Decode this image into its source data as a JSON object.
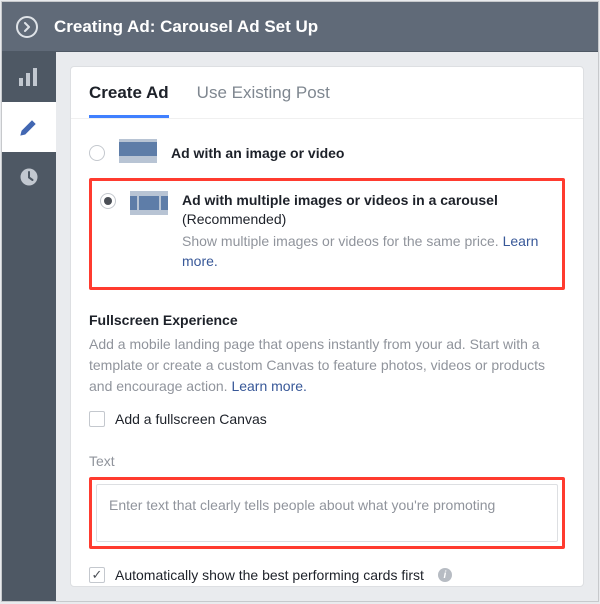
{
  "header": {
    "title": "Creating Ad: Carousel Ad Set Up"
  },
  "tabs": {
    "create": "Create Ad",
    "existing": "Use Existing Post"
  },
  "format": {
    "option1_label": "Ad with an image or video",
    "option2_label": "Ad with multiple images or videos in a carousel",
    "option2_rec": "(Recommended)",
    "option2_desc": "Show multiple images or videos for the same price. ",
    "option2_link": "Learn more."
  },
  "fullscreen": {
    "heading": "Fullscreen Experience",
    "desc": "Add a mobile landing page that opens instantly from your ad. Start with a template or create a custom Canvas to feature photos, videos or products and encourage action. ",
    "link": "Learn more.",
    "checkbox_label": "Add a fullscreen Canvas"
  },
  "text": {
    "label": "Text",
    "placeholder": "Enter text that clearly tells people about what you're promoting"
  },
  "auto": {
    "label": "Automatically show the best performing cards first"
  }
}
